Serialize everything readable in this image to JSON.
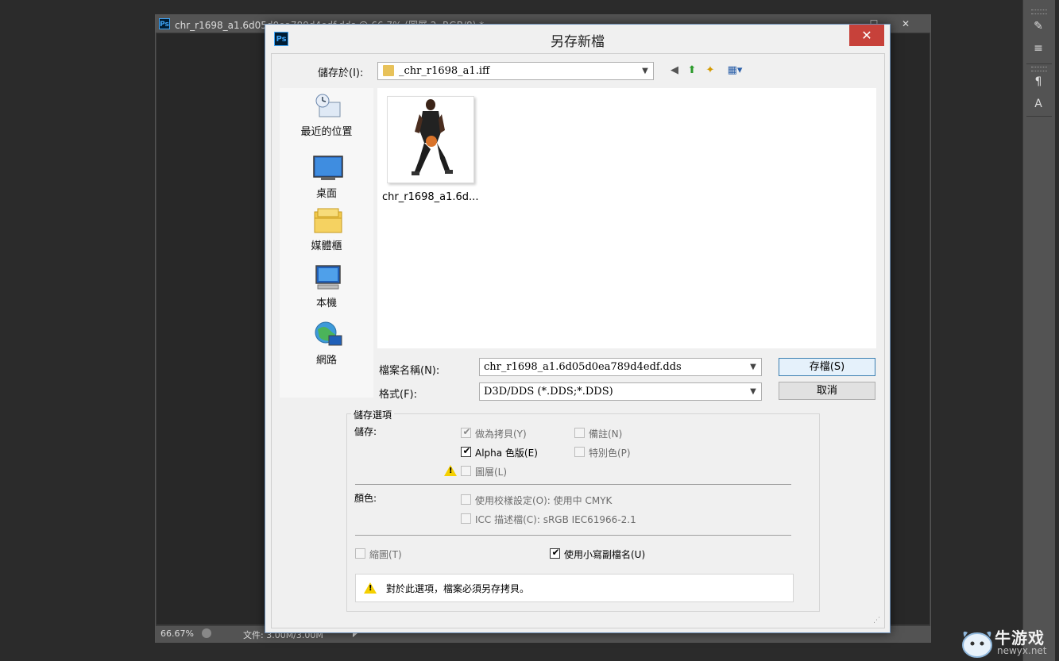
{
  "photoshop": {
    "doc_title": "chr_r1698_a1.6d05d0ea789d4edf.dds @ 66.7% (圖層 2, RGB/8) *",
    "logo": "Ps",
    "zoom": "66.67%",
    "doc_info": "文件: 3.00M/3.00M",
    "window_controls": {
      "minimize": "—",
      "maximize": "☐",
      "close": "✕"
    }
  },
  "dialog": {
    "logo": "Ps",
    "title": "另存新檔",
    "close_label": "✕",
    "save_in_label": "儲存於(I):",
    "save_in_value": "_chr_r1698_a1.iff",
    "places": [
      {
        "label": "最近的位置",
        "icon": "recent-places-icon"
      },
      {
        "label": "桌面",
        "icon": "desktop-icon"
      },
      {
        "label": "媒體櫃",
        "icon": "libraries-icon"
      },
      {
        "label": "本機",
        "icon": "computer-icon"
      },
      {
        "label": "網路",
        "icon": "network-icon"
      }
    ],
    "files": [
      {
        "name": "chr_r1698_a1.6d...",
        "icon": "image-thumbnail"
      }
    ],
    "filename_label": "檔案名稱(N):",
    "filename_value": "chr_r1698_a1.6d05d0ea789d4edf.dds",
    "format_label": "格式(F):",
    "format_value": "D3D/DDS (*.DDS;*.DDS)",
    "save_button": "存檔(S)",
    "cancel_button": "取消",
    "options": {
      "group_title": "儲存選項",
      "save_label": "儲存:",
      "as_copy": {
        "label": "做為拷貝(Y)",
        "checked": true,
        "enabled": false
      },
      "notes": {
        "label": "備註(N)",
        "checked": false,
        "enabled": false
      },
      "alpha": {
        "label": "Alpha 色版(E)",
        "checked": true,
        "enabled": true
      },
      "spot": {
        "label": "特別色(P)",
        "checked": false,
        "enabled": false
      },
      "layers": {
        "label": "圖層(L)",
        "checked": false,
        "enabled": false
      },
      "color_label": "顏色:",
      "proof": {
        "label": "使用校樣設定(O):  使用中 CMYK",
        "checked": false,
        "enabled": false
      },
      "icc": {
        "label": "ICC 描述檔(C):  sRGB IEC61966-2.1",
        "checked": false,
        "enabled": false
      },
      "thumbnail": {
        "label": "縮圖(T)",
        "checked": false,
        "enabled": false
      },
      "lowercase": {
        "label": "使用小寫副檔名(U)",
        "checked": true,
        "enabled": true
      },
      "warning_text": "對於此選項，檔案必須另存拷貝。"
    }
  },
  "watermark": {
    "brand": "牛游戏",
    "url": "newyx.net"
  }
}
